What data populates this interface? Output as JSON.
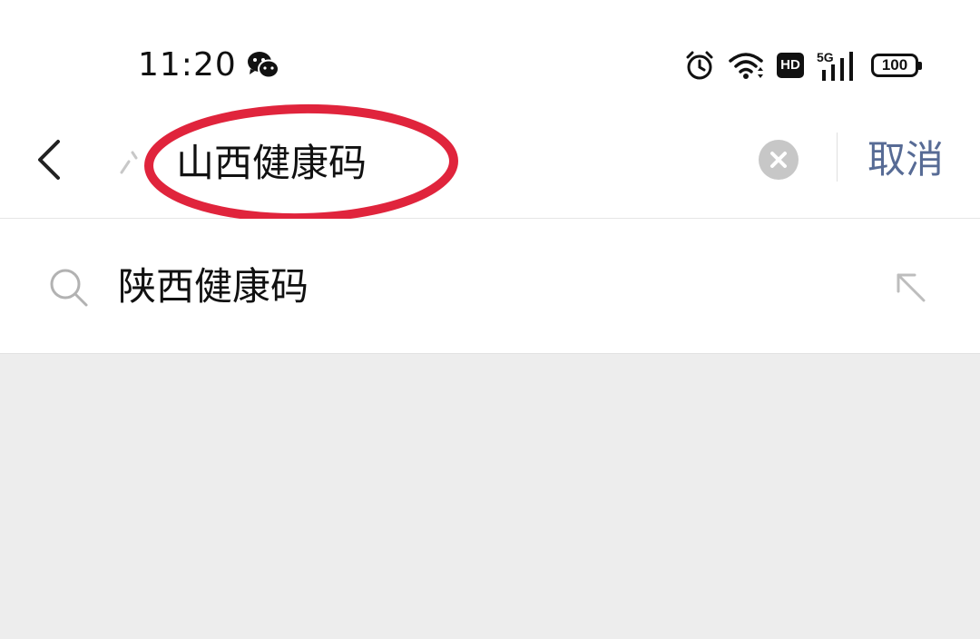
{
  "status_bar": {
    "time": "11:20",
    "icons": [
      "wechat-icon",
      "alarm-icon",
      "wifi-icon",
      "hd-icon",
      "signal-5g-icon",
      "battery-icon"
    ],
    "hd_label": "HD",
    "network_label": "5G",
    "battery_level": "100"
  },
  "search": {
    "query": "山西健康码",
    "cancel_label": "取消",
    "highlight_color": "#e0243c"
  },
  "suggestions": [
    {
      "text": "陕西健康码",
      "icon": "search-icon",
      "action_icon": "fill-arrow-icon"
    }
  ],
  "colors": {
    "accent": "#576b95",
    "background": "#ededed"
  }
}
